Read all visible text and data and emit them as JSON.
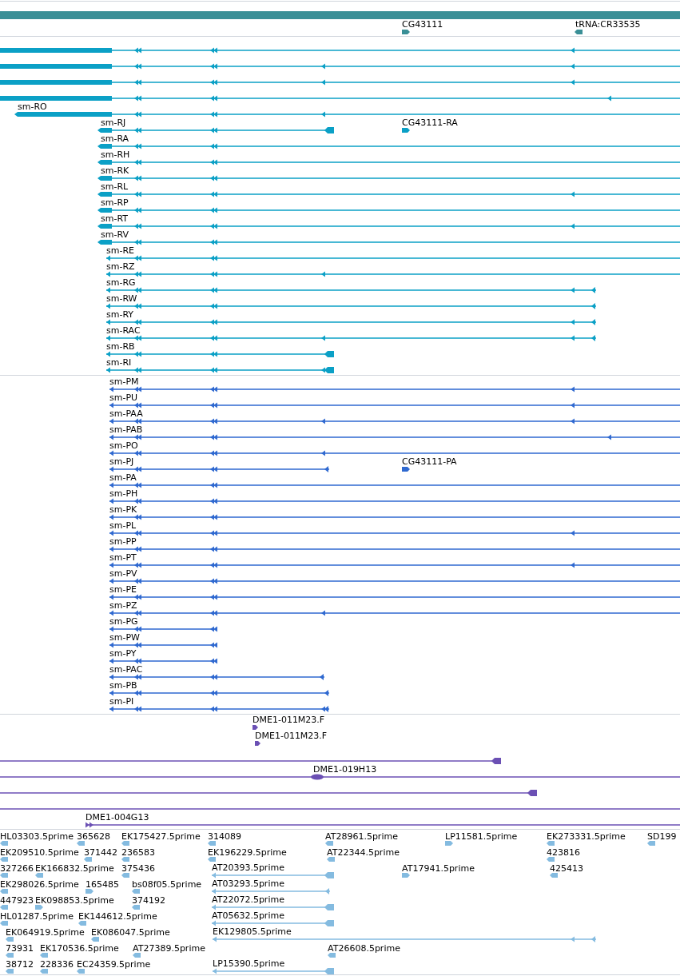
{
  "tracks": [
    {
      "kind": "gene",
      "labels": [
        "CG43111",
        "tRNA:CR33535"
      ]
    },
    {
      "kind": "transcript",
      "labels": [
        "sm-RO",
        "sm-RJ",
        "CG43111-RA",
        "sm-RA",
        "sm-RH",
        "sm-RK",
        "sm-RL",
        "sm-RP",
        "sm-RT",
        "sm-RV",
        "sm-RE",
        "sm-RZ",
        "sm-RG",
        "sm-RW",
        "sm-RY",
        "sm-RAC",
        "sm-RB",
        "sm-RI"
      ]
    },
    {
      "kind": "protein",
      "labels": [
        "sm-PM",
        "sm-PU",
        "sm-PAA",
        "sm-PAB",
        "sm-PO",
        "sm-PJ",
        "CG43111-PA",
        "sm-PA",
        "sm-PH",
        "sm-PK",
        "sm-PL",
        "sm-PP",
        "sm-PT",
        "sm-PV",
        "sm-PE",
        "sm-PZ",
        "sm-PG",
        "sm-PW",
        "sm-PY",
        "sm-PAC",
        "sm-PB",
        "sm-PI"
      ]
    },
    {
      "kind": "clone",
      "labels": [
        "DME1-011M23.F",
        "DME1-011M23.F",
        "DME1-019H13",
        "DME1-004G13"
      ]
    },
    {
      "kind": "est",
      "labels": [
        "HL03303.5prime",
        "365628",
        "EK175427.5prime",
        "314089",
        "AT28961.5prime",
        "LP11581.5prime",
        "EK273331.5prime",
        "SD199",
        "EK209510.5prime",
        "371442",
        "236583",
        "EK196229.5prime",
        "AT22344.5prime",
        "423816",
        "327266",
        "EK166832.5prime",
        "375436",
        "AT20393.5prime",
        "AT17941.5prime",
        "425413",
        "EK298026.5prime",
        "165485",
        "bs08f05.5prime",
        "AT03293.5prime",
        "447923",
        "EK098853.5prime",
        "374192",
        "AT22072.5prime",
        "HL01287.5prime",
        "EK144612.5prime",
        "AT05632.5prime",
        "EK064919.5prime",
        "EK086047.5prime",
        "EK129805.5prime",
        "73931",
        "EK170536.5prime",
        "AT27389.5prime",
        "AT26608.5prime",
        "38712",
        "228336",
        "EC24359.5prime",
        "LP15390.5prime"
      ]
    }
  ]
}
